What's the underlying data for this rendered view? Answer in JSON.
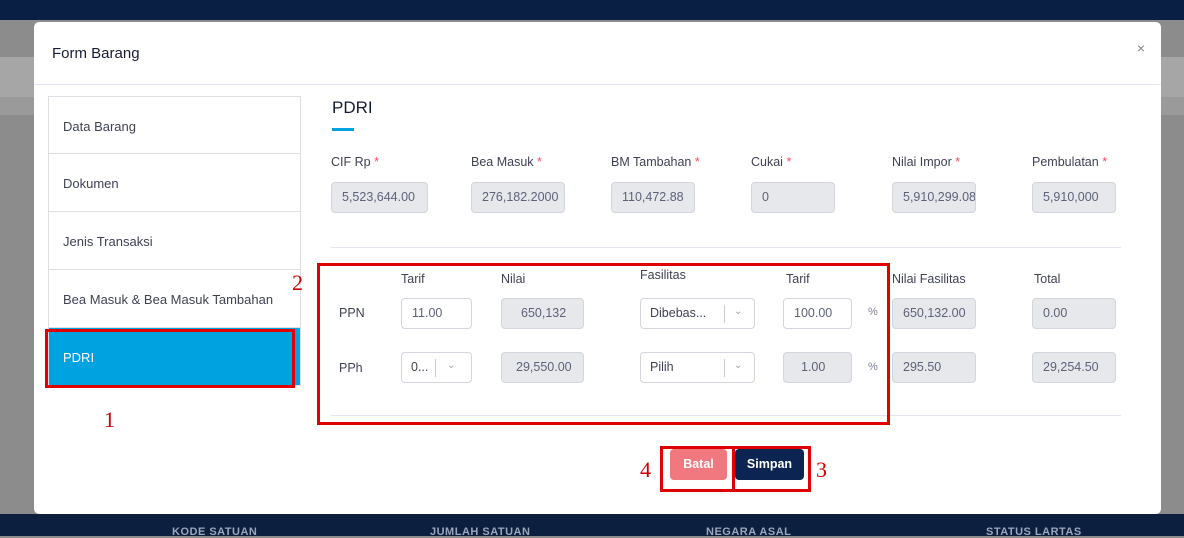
{
  "background": {
    "footer_columns": [
      "KODE SATUAN",
      "JUMLAH SATUAN",
      "NEGARA ASAL",
      "STATUS LARTAS"
    ]
  },
  "modal": {
    "title": "Form Barang",
    "close_label": "×"
  },
  "nav": {
    "items": [
      {
        "label": "Data Barang",
        "active": false
      },
      {
        "label": "Dokumen",
        "active": false
      },
      {
        "label": "Jenis Transaksi",
        "active": false
      },
      {
        "label": "Bea Masuk & Bea Masuk Tambahan",
        "active": false
      },
      {
        "label": "PDRI",
        "active": true
      }
    ]
  },
  "section": {
    "title": "PDRI",
    "required_mark": "*"
  },
  "summary": {
    "cif_label": "CIF Rp",
    "cif_value": "5,523,644.00",
    "bea_masuk_label": "Bea Masuk",
    "bea_masuk_value": "276,182.2000",
    "bm_tambahan_label": "BM Tambahan",
    "bm_tambahan_value": "110,472.88",
    "cukai_label": "Cukai",
    "cukai_value": "0",
    "nilai_impor_label": "Nilai Impor",
    "nilai_impor_value": "5,910,299.0800",
    "pembulatan_label": "Pembulatan",
    "pembulatan_value": "5,910,000"
  },
  "table": {
    "headers": {
      "tarif": "Tarif",
      "nilai": "Nilai",
      "fasilitas": "Fasilitas",
      "tarif_fasilitas": "Tarif",
      "nilai_fasilitas": "Nilai Fasilitas",
      "total": "Total"
    },
    "percent_sign": "%",
    "rows": [
      {
        "label": "PPN",
        "tarif": "11.00",
        "nilai": "650,132",
        "fasilitas": "Dibebas...",
        "tarif_fasilitas": "100.00",
        "nilai_fasilitas": "650,132.00",
        "total": "0.00"
      },
      {
        "label": "PPh",
        "tarif": "0...",
        "nilai": "29,550.00",
        "fasilitas": "Pilih",
        "tarif_fasilitas": "1.00",
        "nilai_fasilitas": "295.50",
        "total": "29,254.50"
      }
    ]
  },
  "buttons": {
    "batal": "Batal",
    "simpan": "Simpan"
  },
  "annotations": {
    "n1": "1",
    "n2": "2",
    "n3": "3",
    "n4": "4",
    "color": "#e00000"
  },
  "colors": {
    "accent": "#00a2e0",
    "batal": "#f1787f",
    "simpan": "#0b2452"
  }
}
